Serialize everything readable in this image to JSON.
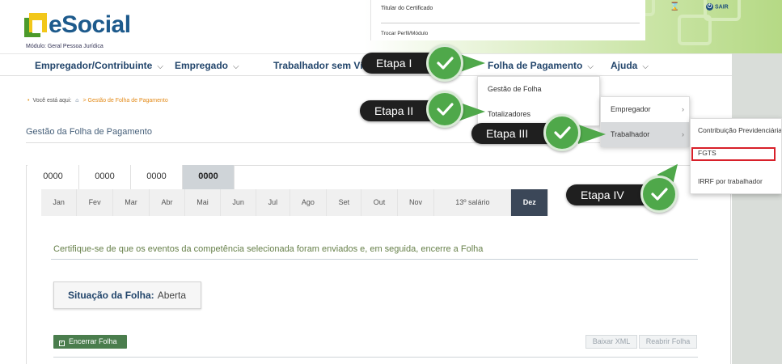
{
  "header": {
    "logo_text": "eSocial",
    "module": "Módulo: Geral Pessoa Jurídica",
    "certificate_label": "Titular do Certificado",
    "switch_profile": "Trocar Perfil/Módulo",
    "hourglass_icon": "⌛",
    "exit_label": "SAIR",
    "power_icon": "⏻"
  },
  "nav": {
    "items": [
      {
        "label": "Empregador/Contribuinte",
        "chevron": "⌵"
      },
      {
        "label": "Empregado",
        "chevron": "⌵"
      },
      {
        "label": "Trabalhador sem Vínculo",
        "chevron": "⌵"
      },
      {
        "label": "Folha de Pagamento",
        "chevron": "⌵"
      },
      {
        "label": "Ajuda",
        "chevron": "⌵"
      }
    ]
  },
  "breadcrumb": {
    "prefix": "Você está aqui:",
    "home_icon": "⌂",
    "separator": ">",
    "current": "Gestão de Folha de Pagamento"
  },
  "section_title": "Gestão da Folha de Pagamento",
  "years": [
    "0000",
    "0000",
    "0000",
    "0000"
  ],
  "months": [
    "Jan",
    "Fev",
    "Mar",
    "Abr",
    "Mai",
    "Jun",
    "Jul",
    "Ago",
    "Set",
    "Out",
    "Nov",
    "13º salário",
    "Dez"
  ],
  "instruction": "Certifique-se de que os eventos da competência selecionada foram enviados e, em seguida, encerre a Folha",
  "status": {
    "label": "Situação da Folha:",
    "value": "Aberta"
  },
  "buttons": {
    "close_payroll": "Encerrar Folha",
    "close_icon": "✓",
    "download_xml": "Baixar XML",
    "reopen_payroll": "Reabrir Folha"
  },
  "menu_folha": {
    "items": [
      "Gestão de Folha",
      "Totalizadores"
    ]
  },
  "menu_totalizadores": {
    "items": [
      "Empregador",
      "Trabalhador"
    ],
    "arrow": "›"
  },
  "menu_trabalhador": {
    "items": [
      "Contribuição Previdenciária",
      "FGTS",
      "IRRF por trabalhador"
    ]
  },
  "callouts": {
    "step1": "Etapa I",
    "step2": "Etapa II",
    "step3": "Etapa III",
    "step4": "Etapa IV"
  },
  "colors": {
    "callout_bg": "#1f1f1f",
    "check_green": "#4fa84a",
    "highlight_red": "#d8202a",
    "nav_text": "#22456b",
    "active_month": "#3b4758"
  }
}
